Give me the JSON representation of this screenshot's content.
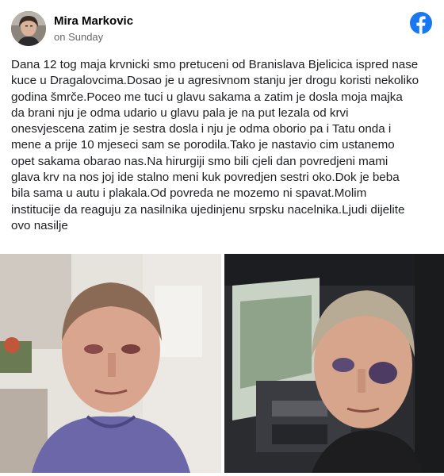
{
  "post": {
    "author": "Mira Markovic",
    "timestamp": "on Sunday",
    "brand_icon": "facebook-icon",
    "brand_color": "#1877f2",
    "text": "Dana 12 tog maja krvnicki smo pretuceni od Branislava Bjelicica ispred nase\nkuce u Dragalovcima.Dosao je u agresivnom stanju jer drogu koristi nekoliko\ngodina šmrče.Poceo me tuci u glavu sakama a zatim je dosla moja majka\nda brani nju je odma udario u glavu pala je na put lezala od krvi\nonesvjescena zatim je sestra dosla i nju je odma oborio pa i Tatu onda i\nmene a prije 10 mjeseci sam se porodila.Tako je nastavio cim ustanemo\nopet sakama obarao nas.Na hirurgiji smo bili cjeli dan povredjeni mami\nglava krv na nos joj ide stalno meni kuk povredjen sestri oko.Dok je beba\nbila sama u autu i plakala.Od povreda ne mozemo ni spavat.Molim\ninstitucije da reaguju za nasilnika ujedinjenu srpsku nacelnika.Ljudi dijelite\novo nasilje"
  }
}
